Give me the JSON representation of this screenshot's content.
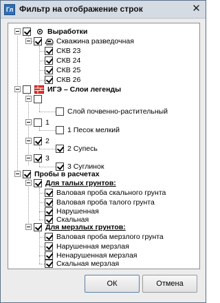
{
  "window": {
    "title": "Фильтр на отображение строк",
    "app_icon_text": "Гл",
    "close_glyph": "✕"
  },
  "tree": {
    "workings": {
      "label": "Выработки",
      "checked": true
    },
    "well_type": {
      "label": "Скважина разведочная",
      "checked": true
    },
    "wells": [
      {
        "label": "СКВ 23",
        "checked": true
      },
      {
        "label": "СКВ 24",
        "checked": true
      },
      {
        "label": "СКВ 25",
        "checked": true
      },
      {
        "label": "СКВ 26",
        "checked": true
      }
    ],
    "ige": {
      "label": "ИГЭ – Слои легенды",
      "checked": false
    },
    "ige_groups": [
      {
        "number": "",
        "checked": false,
        "layer": "Слой почвенно-растительный",
        "layer_checked": false
      },
      {
        "number": "1",
        "checked": false,
        "layer": "1 Песок мелкий",
        "layer_checked": false
      },
      {
        "number": "2",
        "checked": true,
        "layer": "2 Супесь",
        "layer_checked": true
      },
      {
        "number": "3",
        "checked": true,
        "layer": "3 Суглинок",
        "layer_checked": true
      }
    ],
    "samples": {
      "label": "Пробы в расчетах",
      "checked": true
    },
    "thawed": {
      "label": "Для талых грунтов:",
      "checked": true,
      "items": [
        {
          "label": "Валовая проба скального грунта",
          "checked": true
        },
        {
          "label": "Валовая проба талого грунта",
          "checked": true
        },
        {
          "label": "Нарушенная",
          "checked": true
        },
        {
          "label": "Скальная",
          "checked": true
        }
      ]
    },
    "frozen": {
      "label": "Для мерзлых грунтов:",
      "checked": true,
      "items": [
        {
          "label": "Валовая проба мерзлого грунта",
          "checked": true
        },
        {
          "label": "Нарушенная мерзлая",
          "checked": true
        },
        {
          "label": "Ненарушенная мерзлая",
          "checked": true
        },
        {
          "label": "Скальная мерзлая",
          "checked": true
        }
      ]
    }
  },
  "buttons": {
    "ok": "ОК",
    "cancel": "Отмена"
  }
}
